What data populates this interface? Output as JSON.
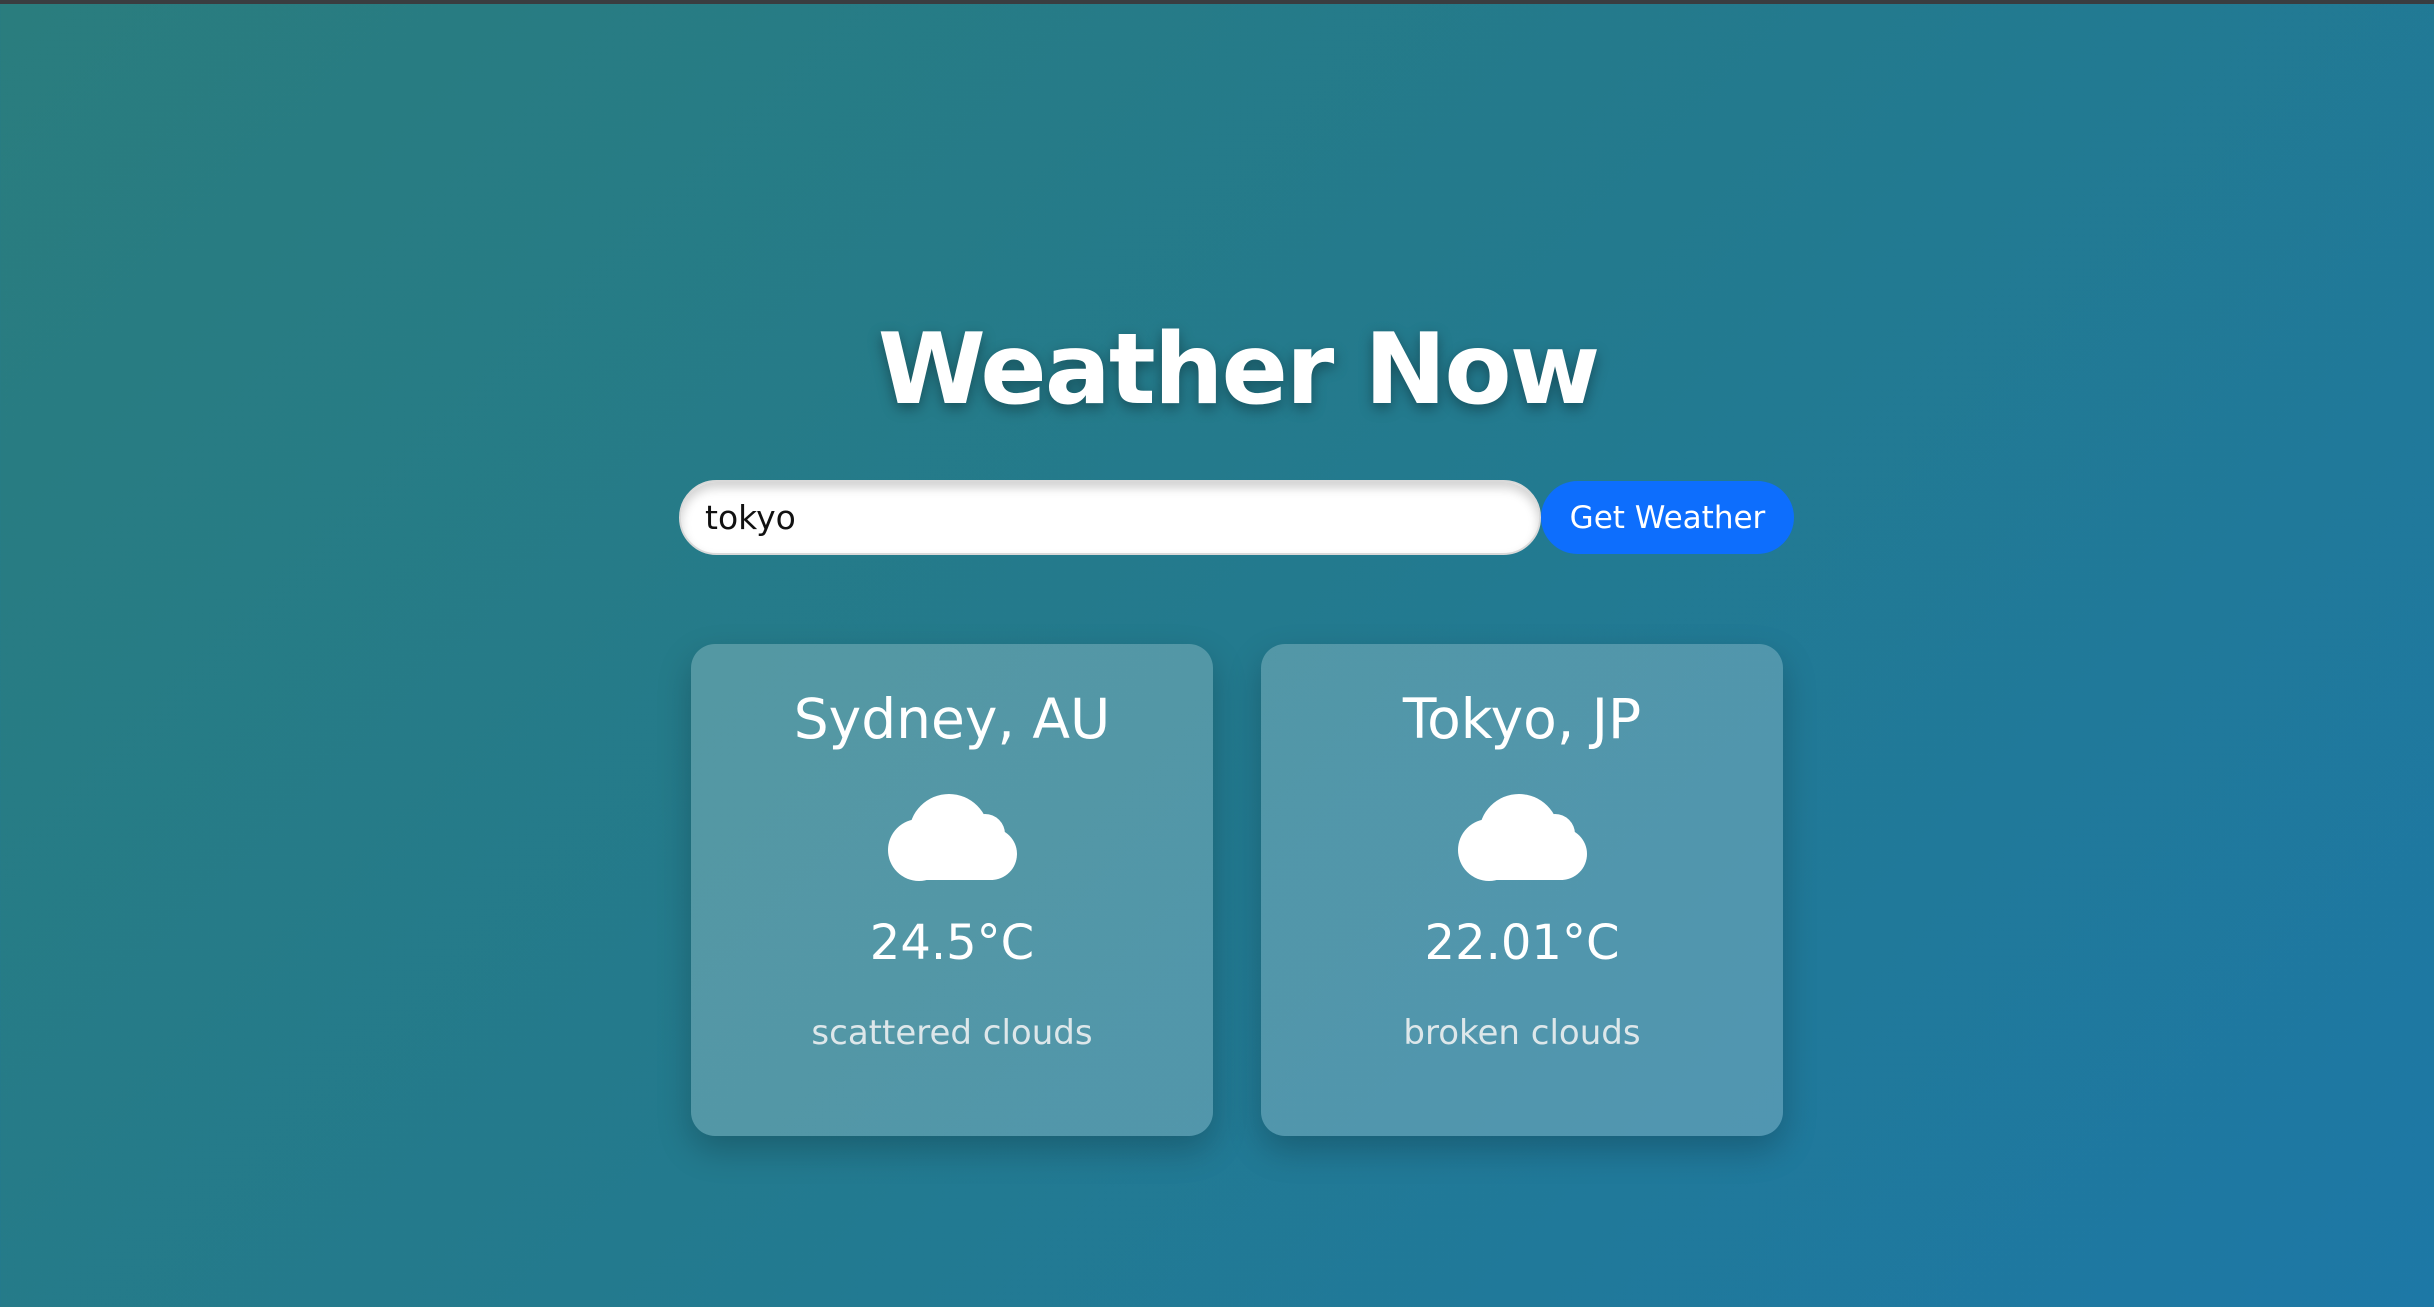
{
  "app": {
    "title": "Weather Now"
  },
  "search": {
    "value": "tokyo",
    "button_label": "Get Weather"
  },
  "colors": {
    "button_accent": "#0d6efd",
    "background_start": "#2a7d7e",
    "background_end": "#1d78a6"
  },
  "cards": [
    {
      "city": "Sydney, AU",
      "icon": "cloud-icon",
      "temperature": "24.5°C",
      "description": "scattered clouds"
    },
    {
      "city": "Tokyo, JP",
      "icon": "cloud-icon",
      "temperature": "22.01°C",
      "description": "broken clouds"
    }
  ]
}
